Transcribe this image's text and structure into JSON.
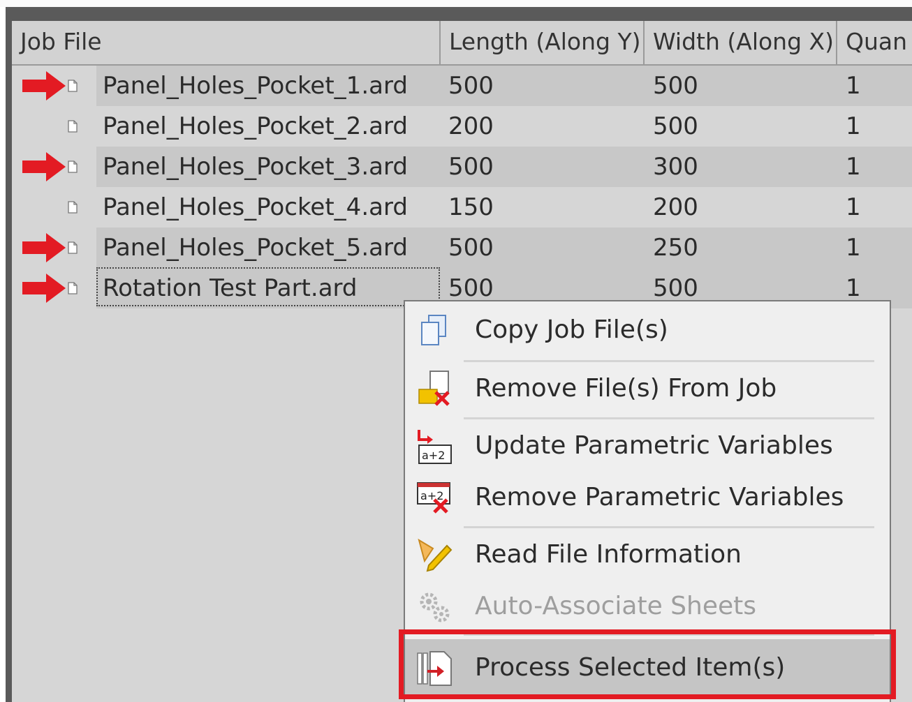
{
  "table": {
    "columns": [
      "Job File",
      "Length (Along Y)",
      "Width (Along X)",
      "Quan"
    ],
    "rows": [
      {
        "file": "Panel_Holes_Pocket_1.ard",
        "length": "500",
        "width": "500",
        "qty": "1",
        "flagged": true
      },
      {
        "file": "Panel_Holes_Pocket_2.ard",
        "length": "200",
        "width": "500",
        "qty": "1",
        "flagged": false
      },
      {
        "file": "Panel_Holes_Pocket_3.ard",
        "length": "500",
        "width": "300",
        "qty": "1",
        "flagged": true
      },
      {
        "file": "Panel_Holes_Pocket_4.ard",
        "length": "150",
        "width": "200",
        "qty": "1",
        "flagged": false
      },
      {
        "file": "Panel_Holes_Pocket_5.ard",
        "length": "500",
        "width": "250",
        "qty": "1",
        "flagged": true
      },
      {
        "file": "Rotation Test Part.ard",
        "length": "500",
        "width": "500",
        "qty": "1",
        "flagged": true
      }
    ]
  },
  "context_menu": {
    "items": [
      {
        "label": "Copy Job File(s)",
        "icon": "copy-icon",
        "enabled": true
      },
      {
        "label": "Remove File(s) From Job",
        "icon": "remove-file-icon",
        "enabled": true
      },
      {
        "label": "Update Parametric Variables",
        "icon": "update-variables-icon",
        "enabled": true
      },
      {
        "label": "Remove Parametric Variables",
        "icon": "remove-variables-icon",
        "enabled": true
      },
      {
        "label": "Read File Information",
        "icon": "read-info-icon",
        "enabled": true
      },
      {
        "label": "Auto-Associate Sheets",
        "icon": "gears-icon",
        "enabled": false
      },
      {
        "label": "Process Selected Item(s)",
        "icon": "process-icon",
        "enabled": true,
        "highlighted": true
      }
    ]
  },
  "colors": {
    "annotation_red": "#e31b23",
    "row_shade": "#c8c8c8",
    "grid_bg": "#d6d6d6",
    "menu_bg": "#efefef"
  }
}
